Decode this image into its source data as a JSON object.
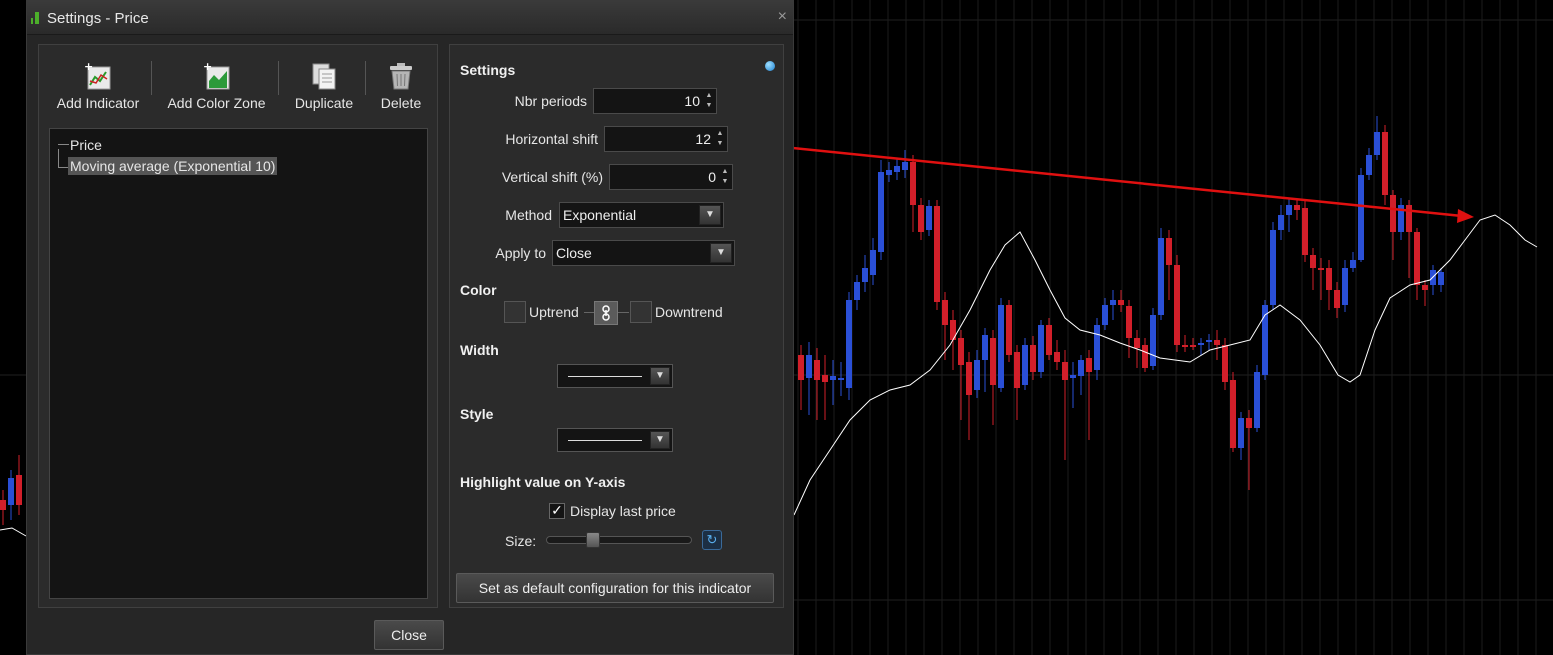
{
  "dialog": {
    "title": "Settings - Price",
    "close_glyph": "×",
    "close_label": "Close"
  },
  "toolbar": {
    "add_indicator": "Add Indicator",
    "add_color_zone": "Add Color Zone",
    "duplicate": "Duplicate",
    "delete": "Delete"
  },
  "tree": {
    "items": [
      "Price",
      "Moving average (Exponential 10)"
    ]
  },
  "settings": {
    "heading": "Settings",
    "nbr_periods_label": "Nbr periods",
    "nbr_periods_value": "10",
    "horizontal_shift_label": "Horizontal shift",
    "horizontal_shift_value": "12",
    "vertical_shift_label": "Vertical shift (%)",
    "vertical_shift_value": "0",
    "method_label": "Method",
    "method_value": "Exponential",
    "apply_to_label": "Apply to",
    "apply_to_value": "Close",
    "color_heading": "Color",
    "uptrend_label": "Uptrend",
    "downtrend_label": "Downtrend",
    "width_heading": "Width",
    "style_heading": "Style",
    "highlight_heading": "Highlight value on Y-axis",
    "display_last_price_label": "Display last price",
    "display_last_price_checked": true,
    "size_label": "Size:",
    "size_value": 0.3,
    "default_button": "Set as default configuration for this indicator"
  },
  "colors": {
    "up_candle": "#2a4fd6",
    "down_candle": "#d21f2a",
    "moving_average": "#ffffff",
    "arrow": "#e01010"
  },
  "icons": {
    "link": "link-icon",
    "check": "check-icon",
    "reset": "reset-icon",
    "info": "info-dot-icon"
  }
}
